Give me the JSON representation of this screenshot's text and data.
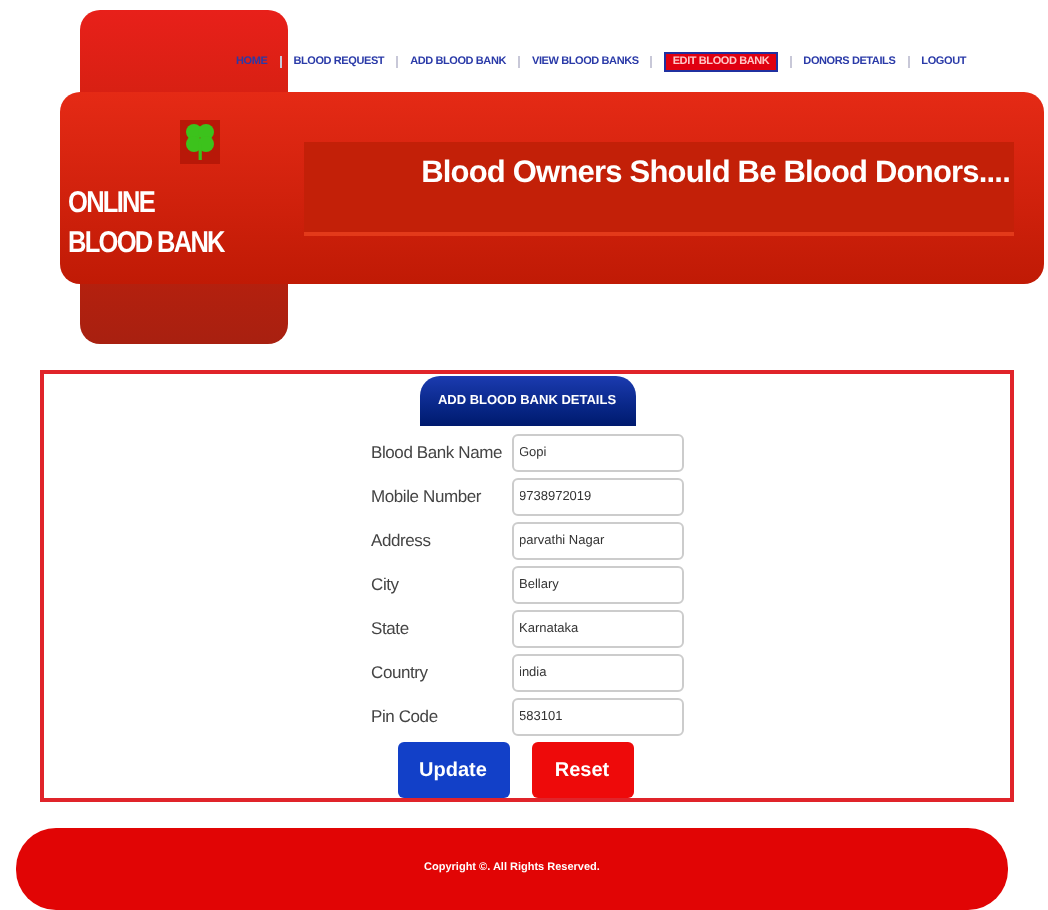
{
  "nav": [
    {
      "label": "HOME",
      "selected": false
    },
    {
      "label": "BLOOD REQUEST",
      "selected": false
    },
    {
      "label": "ADD BLOOD BANK",
      "selected": false
    },
    {
      "label": "VIEW BLOOD BANKS",
      "selected": false
    },
    {
      "label": "EDIT BLOOD BANK",
      "selected": true
    },
    {
      "label": "DONORS DETAILS",
      "selected": false
    },
    {
      "label": "LOGOUT",
      "selected": false
    }
  ],
  "logo": {
    "line_1": "ONLINE",
    "line_2": "BLOOD BANK"
  },
  "slogan": "Blood Owners Should Be Blood Donors....",
  "form": {
    "title": "ADD BLOOD BANK DETAILS",
    "fields": [
      {
        "label": "Blood Bank Name",
        "value": "Gopi"
      },
      {
        "label": "Mobile Number",
        "value": "9738972019"
      },
      {
        "label": "Address",
        "value": "parvathi Nagar"
      },
      {
        "label": "City",
        "value": "Bellary"
      },
      {
        "label": "State",
        "value": "Karnataka"
      },
      {
        "label": "Country",
        "value": "india"
      },
      {
        "label": "Pin Code",
        "value": "583101"
      }
    ],
    "buttons": [
      {
        "label": "Update",
        "kind": "primary"
      },
      {
        "label": "Reset",
        "kind": "reset"
      }
    ]
  },
  "footer": "Copyright ©. All Rights Reserved."
}
